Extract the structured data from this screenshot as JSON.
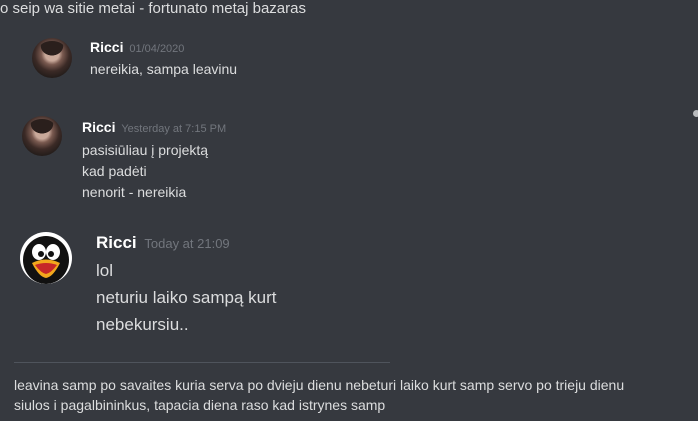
{
  "top_line": "o seip wa sitie metai - fortunato metaj bazaras",
  "messages": [
    {
      "author": "Ricci",
      "timestamp": "01/04/2020",
      "lines": [
        "nereikia, sampa leavinu"
      ],
      "avatar_icon": "photo-avatar-icon"
    },
    {
      "author": "Ricci",
      "timestamp": "Yesterday at 7:15 PM",
      "lines": [
        "pasisiūliau į projektą",
        "kad padėti",
        "nenorit - nereikia"
      ],
      "avatar_icon": "photo-avatar-icon"
    },
    {
      "author": "Ricci",
      "timestamp": "Today at 21:09",
      "lines": [
        "lol",
        "neturiu laiko sampą kurt",
        "nebekursiu.."
      ],
      "avatar_icon": "penguin-avatar-icon"
    }
  ],
  "bottom_text": {
    "line1": "leavina samp po savaites kuria serva po dvieju dienu nebeturi laiko kurt samp servo po trieju dienu",
    "line2": "siulos i pagalbininkus, tapacia diena raso kad istrynes samp"
  },
  "colors": {
    "background": "#36393f",
    "text": "#dcddde",
    "author": "#ffffff",
    "timestamp": "#72767d"
  }
}
